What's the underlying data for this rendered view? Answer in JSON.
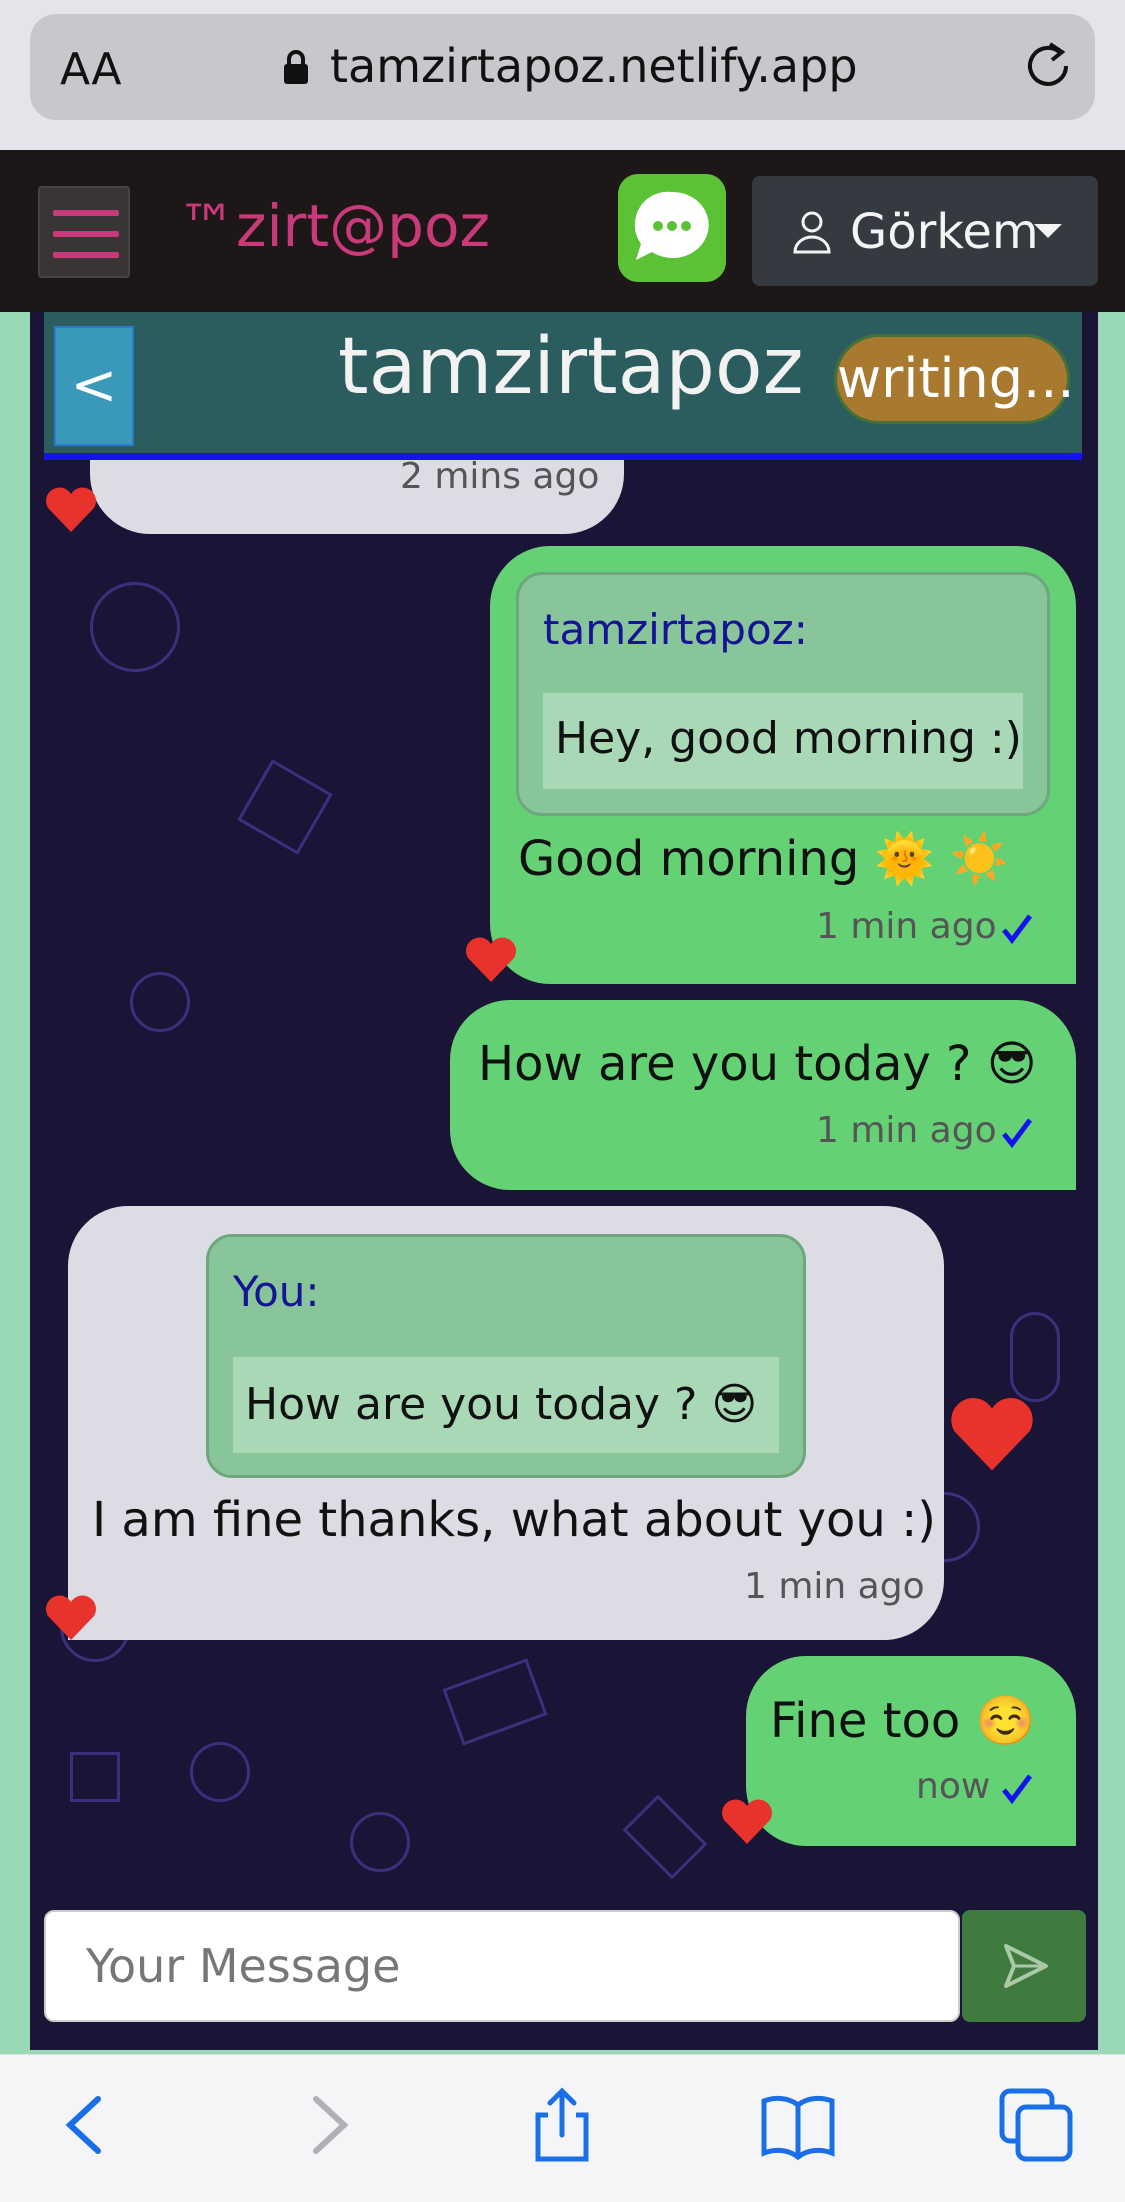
{
  "browser": {
    "text_size_label": "AA",
    "url": "tamzirtapoz.netlify.app"
  },
  "navbar": {
    "brand": "™zirt@poz",
    "user_name": "Görkem"
  },
  "chat": {
    "title": "tamzirtapoz",
    "status": "writing...",
    "back_label": "<",
    "partial_message": {
      "time": "2 mins ago"
    },
    "messages": [
      {
        "direction": "out",
        "quote": {
          "author": "tamzirtapoz:",
          "text": "Hey, good morning :)"
        },
        "text": "Good morning 🌞 ☀️",
        "time": "1 min ago",
        "read": true
      },
      {
        "direction": "out",
        "text": "How are you today ? 😎",
        "time": "1 min ago",
        "read": true
      },
      {
        "direction": "in",
        "quote": {
          "author": "You:",
          "text": "How are you today ? 😎"
        },
        "text": "I am fine thanks, what about you :)",
        "time": "1 min ago"
      },
      {
        "direction": "out",
        "text": "Fine too ☺️",
        "time": "now",
        "read": true
      }
    ]
  },
  "composer": {
    "placeholder": "Your Message"
  },
  "colors": {
    "brand": "#c93a7a",
    "outgoing_bubble": "#64d174",
    "incoming_bubble": "#dcdce4",
    "read_check": "#1512f0",
    "heart": "#e8322c"
  }
}
